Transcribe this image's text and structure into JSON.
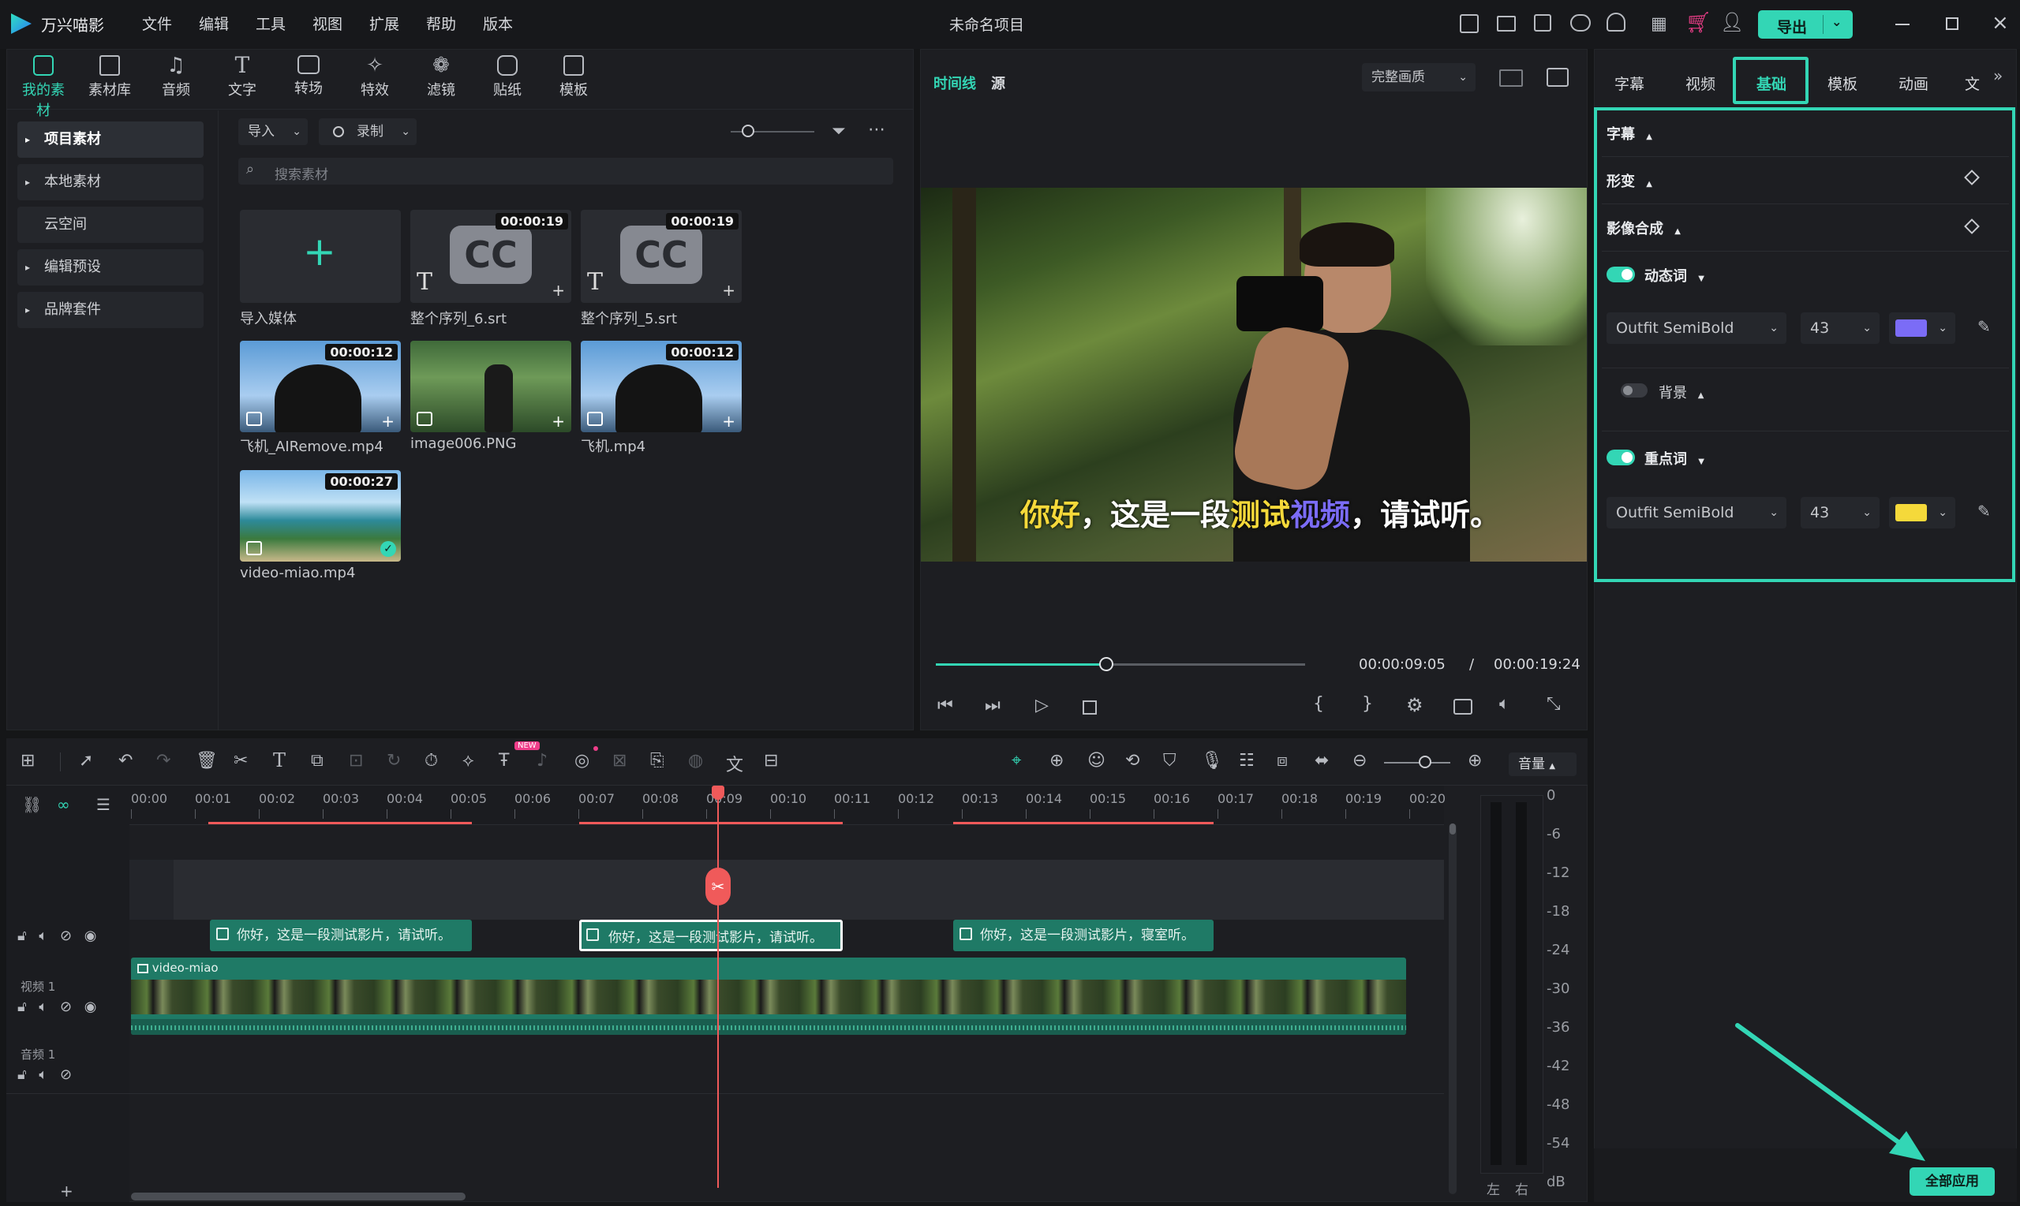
{
  "app": {
    "name": "万兴喵影",
    "title": "未命名项目",
    "export": "导出"
  },
  "menu": [
    "文件",
    "编辑",
    "工具",
    "视图",
    "扩展",
    "帮助",
    "版本"
  ],
  "toolbar": [
    "我的素材",
    "素材库",
    "音频",
    "文字",
    "转场",
    "特效",
    "滤镜",
    "贴纸",
    "模板"
  ],
  "sidebar": [
    "项目素材",
    "本地素材",
    "云空间",
    "编辑预设",
    "品牌套件"
  ],
  "media_bar": {
    "import": "导入",
    "record": "录制",
    "search_placeholder": "搜索素材"
  },
  "media": [
    {
      "name": "导入媒体",
      "type": "import"
    },
    {
      "name": "整个序列_6.srt",
      "duration": "00:00:19",
      "type": "cc"
    },
    {
      "name": "整个序列_5.srt",
      "duration": "00:00:19",
      "type": "cc"
    },
    {
      "name": "飞机_AIRemove.mp4",
      "duration": "00:00:12",
      "type": "video"
    },
    {
      "name": "image006.PNG",
      "duration": "",
      "type": "image"
    },
    {
      "name": "飞机.mp4",
      "duration": "00:00:12",
      "type": "video"
    },
    {
      "name": "video-miao.mp4",
      "duration": "00:00:27",
      "type": "beach"
    }
  ],
  "preview": {
    "tab_timeline": "时间线",
    "tab_source": "源",
    "quality": "完整画质",
    "subtitle": [
      "你好",
      "，这是一段",
      "测试",
      "视频",
      "，请试听。"
    ],
    "current": "00:00:09:05",
    "sep": "/",
    "total": "00:00:19:24",
    "progress": 0.46
  },
  "right_tabs": [
    "字幕",
    "视频",
    "基础",
    "模板",
    "动画",
    "文"
  ],
  "props": {
    "subtitle": "字幕",
    "transform": "形变",
    "composite": "影像合成",
    "dynamic": "动态词",
    "font1": "Outfit SemiBold",
    "size1": "43",
    "color1": "#7b6cf6",
    "bg": "背景",
    "key": "重点词",
    "font2": "Outfit SemiBold",
    "size2": "43",
    "color2": "#f5d93a",
    "apply_all": "全部应用"
  },
  "timeline": {
    "volume_label": "音量",
    "ticks": [
      "00:00",
      "00:01",
      "00:02",
      "00:03",
      "00:04",
      "00:05",
      "00:06",
      "00:07",
      "00:08",
      "00:09",
      "00:10",
      "00:11",
      "00:12",
      "00:13",
      "00:14",
      "00:15",
      "00:16",
      "00:17",
      "00:18",
      "00:19",
      "00:20"
    ],
    "subs": [
      "你好，这是一段测试影片，请试听。",
      "你好，这是一段测试影片，请试听。",
      "你好，这是一段测试影片，寝室听。"
    ],
    "video_clip": "video-miao",
    "track_video": "视频 1",
    "track_audio": "音频 1",
    "meter_labels": [
      "0",
      "-6",
      "-12",
      "-18",
      "-24",
      "-30",
      "-36",
      "-42",
      "-48",
      "-54",
      "dB"
    ],
    "meter_lr": [
      "左",
      "右"
    ],
    "new_badge": "NEW"
  },
  "colors": {
    "accent": "#33d6b5",
    "playhead": "#f05a5a"
  }
}
